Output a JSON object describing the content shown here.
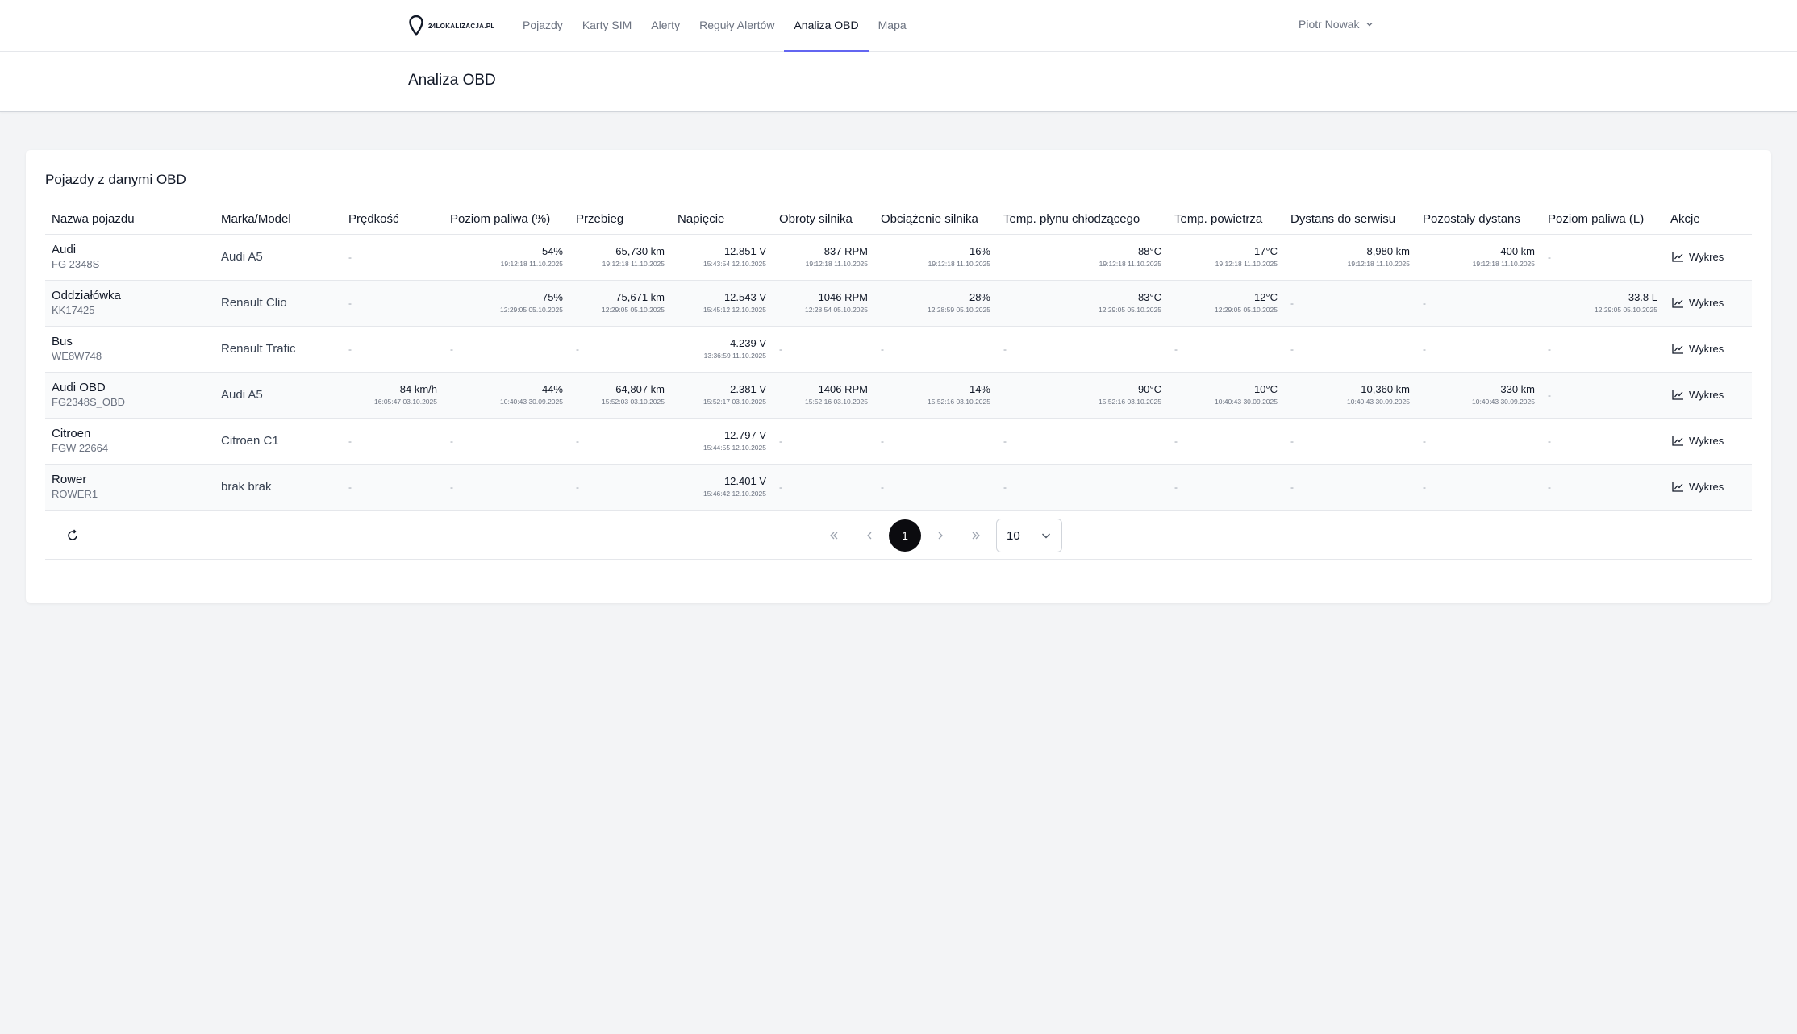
{
  "header": {
    "logo_text": "24LOKALIZACJA.PL",
    "nav": [
      {
        "label": "Pojazdy",
        "active": false
      },
      {
        "label": "Karty SIM",
        "active": false
      },
      {
        "label": "Alerty",
        "active": false
      },
      {
        "label": "Reguły Alertów",
        "active": false
      },
      {
        "label": "Analiza OBD",
        "active": true
      },
      {
        "label": "Mapa",
        "active": false
      }
    ],
    "user_name": "Piotr Nowak"
  },
  "page": {
    "title": "Analiza OBD"
  },
  "card": {
    "title": "Pojazdy z danymi OBD"
  },
  "table": {
    "columns": [
      "Nazwa pojazdu",
      "Marka/Model",
      "Prędkość",
      "Poziom paliwa (%)",
      "Przebieg",
      "Napięcie",
      "Obroty silnika",
      "Obciążenie silnika",
      "Temp. płynu chłodzącego",
      "Temp. powietrza",
      "Dystans do serwisu",
      "Pozostały dystans",
      "Poziom paliwa (L)",
      "Akcje"
    ],
    "action_label": "Wykres",
    "empty": "-",
    "rows": [
      {
        "name": "Audi",
        "plate": "FG 2348S",
        "brand": "Audi A5",
        "cells": [
          null,
          {
            "v": "54%",
            "t": "19:12:18 11.10.2025"
          },
          {
            "v": "65,730 km",
            "t": "19:12:18 11.10.2025"
          },
          {
            "v": "12.851 V",
            "t": "15:43:54 12.10.2025"
          },
          {
            "v": "837 RPM",
            "t": "19:12:18 11.10.2025"
          },
          {
            "v": "16%",
            "t": "19:12:18 11.10.2025"
          },
          {
            "v": "88°C",
            "t": "19:12:18 11.10.2025"
          },
          {
            "v": "17°C",
            "t": "19:12:18 11.10.2025"
          },
          {
            "v": "8,980 km",
            "t": "19:12:18 11.10.2025"
          },
          {
            "v": "400 km",
            "t": "19:12:18 11.10.2025"
          },
          null
        ]
      },
      {
        "name": "Oddziałówka",
        "plate": "KK17425",
        "brand": "Renault Clio",
        "cells": [
          null,
          {
            "v": "75%",
            "t": "12:29:05 05.10.2025"
          },
          {
            "v": "75,671 km",
            "t": "12:29:05 05.10.2025"
          },
          {
            "v": "12.543 V",
            "t": "15:45:12 12.10.2025"
          },
          {
            "v": "1046 RPM",
            "t": "12:28:54 05.10.2025"
          },
          {
            "v": "28%",
            "t": "12:28:59 05.10.2025"
          },
          {
            "v": "83°C",
            "t": "12:29:05 05.10.2025"
          },
          {
            "v": "12°C",
            "t": "12:29:05 05.10.2025"
          },
          null,
          null,
          {
            "v": "33.8 L",
            "t": "12:29:05 05.10.2025"
          }
        ]
      },
      {
        "name": "Bus",
        "plate": "WE8W748",
        "brand": "Renault Trafic",
        "cells": [
          null,
          null,
          null,
          {
            "v": "4.239 V",
            "t": "13:36:59 11.10.2025"
          },
          null,
          null,
          null,
          null,
          null,
          null,
          null
        ]
      },
      {
        "name": "Audi OBD",
        "plate": "FG2348S_OBD",
        "brand": "Audi A5",
        "cells": [
          {
            "v": "84 km/h",
            "t": "16:05:47 03.10.2025"
          },
          {
            "v": "44%",
            "t": "10:40:43 30.09.2025"
          },
          {
            "v": "64,807 km",
            "t": "15:52:03 03.10.2025"
          },
          {
            "v": "2.381 V",
            "t": "15:52:17 03.10.2025"
          },
          {
            "v": "1406 RPM",
            "t": "15:52:16 03.10.2025"
          },
          {
            "v": "14%",
            "t": "15:52:16 03.10.2025"
          },
          {
            "v": "90°C",
            "t": "15:52:16 03.10.2025"
          },
          {
            "v": "10°C",
            "t": "10:40:43 30.09.2025"
          },
          {
            "v": "10,360 km",
            "t": "10:40:43 30.09.2025"
          },
          {
            "v": "330 km",
            "t": "10:40:43 30.09.2025"
          },
          null
        ]
      },
      {
        "name": "Citroen",
        "plate": "FGW 22664",
        "brand": "Citroen C1",
        "cells": [
          null,
          null,
          null,
          {
            "v": "12.797 V",
            "t": "15:44:55 12.10.2025"
          },
          null,
          null,
          null,
          null,
          null,
          null,
          null
        ]
      },
      {
        "name": "Rower",
        "plate": "ROWER1",
        "brand": "brak brak",
        "cells": [
          null,
          null,
          null,
          {
            "v": "12.401 V",
            "t": "15:46:42 12.10.2025"
          },
          null,
          null,
          null,
          null,
          null,
          null,
          null
        ]
      }
    ]
  },
  "pagination": {
    "current_page": "1",
    "page_size": "10"
  },
  "colors": {
    "accent": "#6366f1",
    "page_bg": "#f3f4f6",
    "current_page_bg": "#0b0b0f"
  }
}
